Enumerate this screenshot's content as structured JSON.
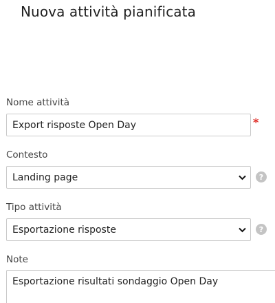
{
  "title": "Nuova attività pianificata",
  "fields": {
    "name": {
      "label": "Nome attività",
      "value": "Export risposte Open Day",
      "required_mark": "*"
    },
    "context": {
      "label": "Contesto",
      "value": "Landing page"
    },
    "type": {
      "label": "Tipo attività",
      "value": "Esportazione risposte"
    },
    "notes": {
      "label": "Note",
      "value": "Esportazione risultati sondaggio Open Day"
    }
  },
  "icons": {
    "help": "?"
  }
}
